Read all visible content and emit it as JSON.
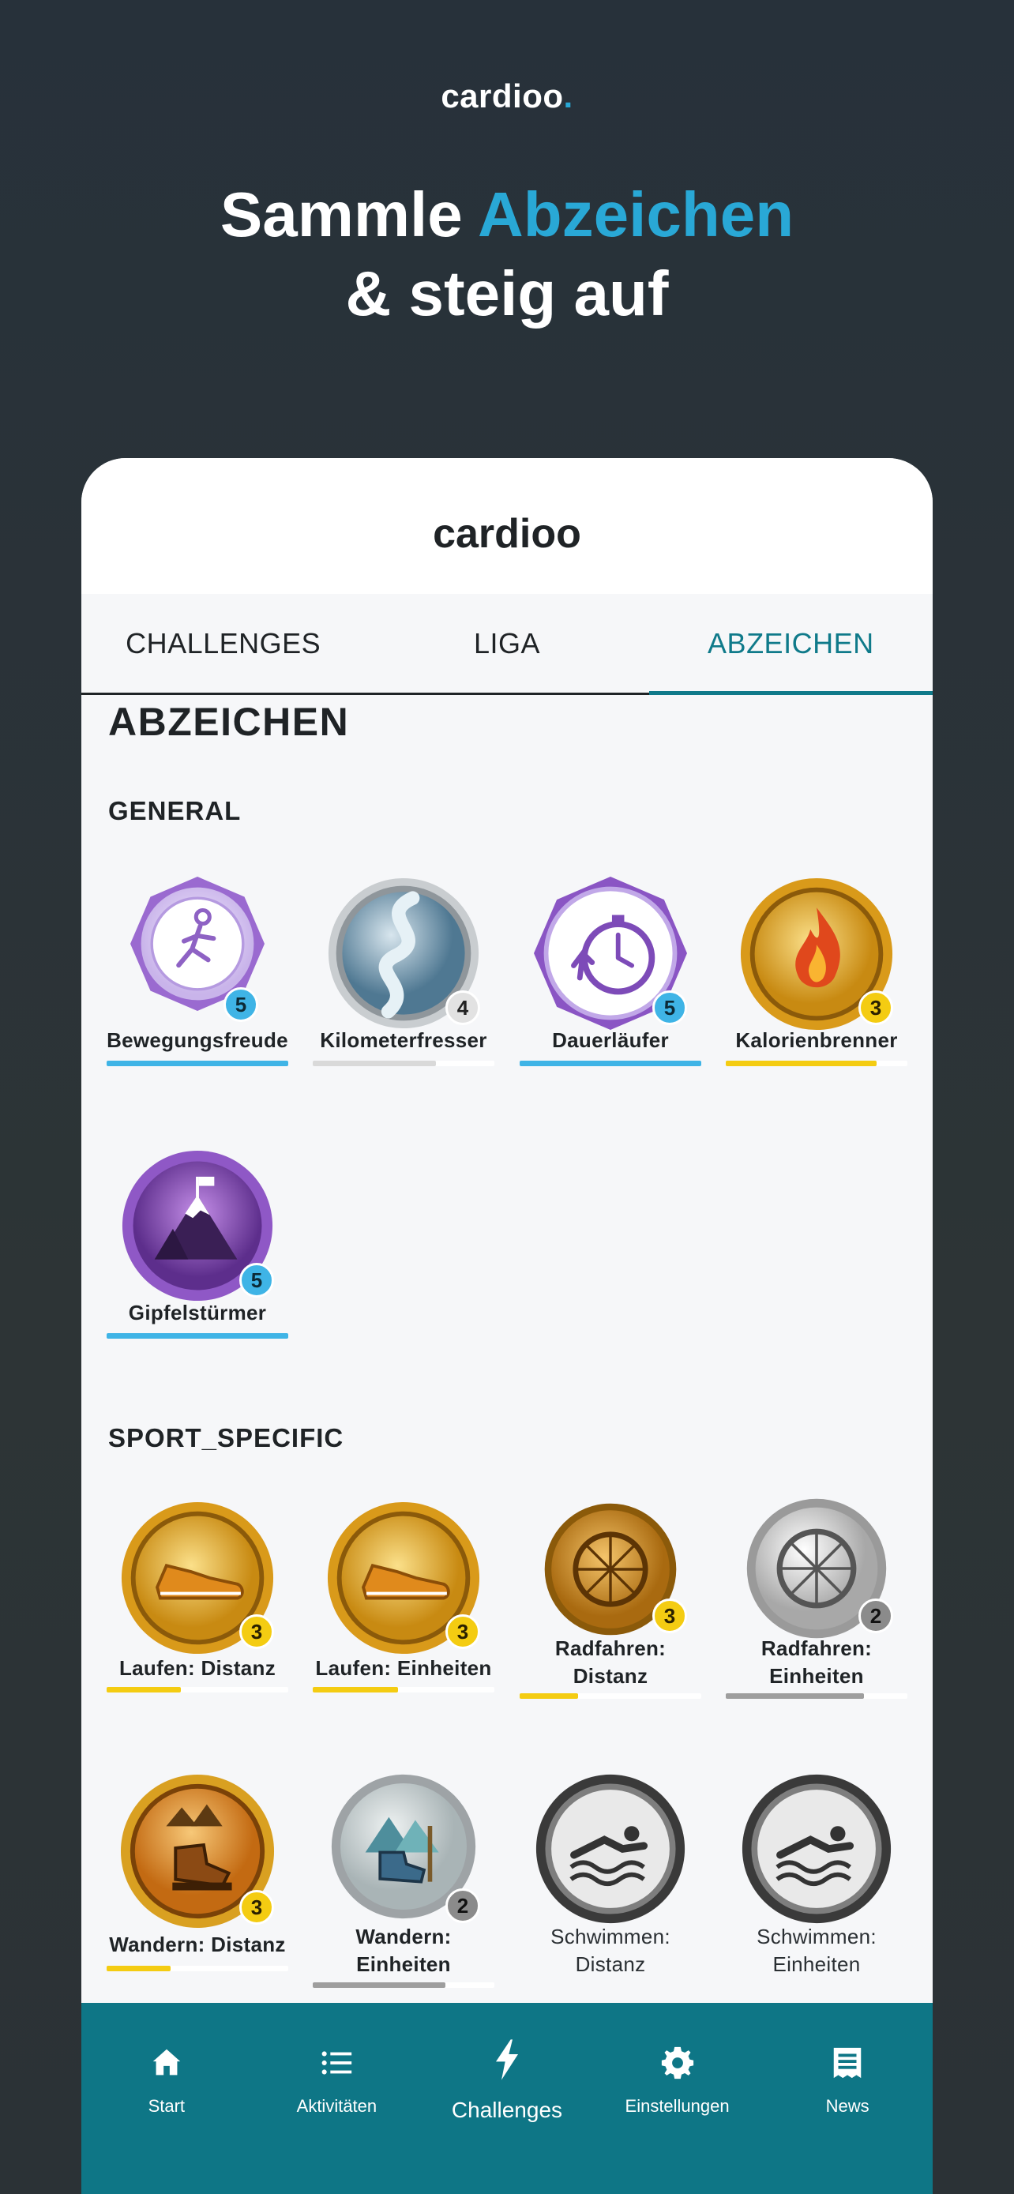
{
  "promo": {
    "brand": "cardioo",
    "brand_dot": ".",
    "headline_part1": "Sammle ",
    "headline_accent": "Abzeichen",
    "headline_line2": "& steig auf"
  },
  "app": {
    "title": "cardioo",
    "tabs": [
      {
        "label": "CHALLENGES",
        "active": false
      },
      {
        "label": "LIGA",
        "active": false
      },
      {
        "label": "ABZEICHEN",
        "active": true
      }
    ],
    "page_title": "ABZEICHEN",
    "sections": [
      {
        "title": "GENERAL",
        "badges": [
          {
            "label": "Bewegungsfreude",
            "level": "5",
            "progress": 1.0,
            "icon": "runner-icon"
          },
          {
            "label": "Kilometerfresser",
            "level": "4",
            "progress": 0.68,
            "icon": "road-icon"
          },
          {
            "label": "Dauerläufer",
            "level": "5",
            "progress": 1.0,
            "icon": "stopwatch-icon"
          },
          {
            "label": "Kalorienbrenner",
            "level": "3",
            "progress": 0.83,
            "icon": "flame-icon"
          },
          {
            "label": "Gipfelstürmer",
            "level": "5",
            "progress": 1.0,
            "icon": "mountain-icon"
          }
        ]
      },
      {
        "title": "SPORT_SPECIFIC",
        "badges": [
          {
            "label": "Laufen: Distanz",
            "level": "3",
            "progress": 0.41,
            "icon": "shoe-icon"
          },
          {
            "label": "Laufen: Einheiten",
            "level": "3",
            "progress": 0.47,
            "icon": "shoe-icon"
          },
          {
            "label": "Radfahren: Distanz",
            "level": "3",
            "progress": 0.32,
            "icon": "bike-wheel-icon"
          },
          {
            "label": "Radfahren: Einheiten",
            "level": "2",
            "progress": 0.76,
            "icon": "bike-wheel-icon"
          },
          {
            "label": "Wandern: Distanz",
            "level": "3",
            "progress": 0.35,
            "icon": "hiking-boot-icon"
          },
          {
            "label": "Wandern: Einheiten",
            "level": "2",
            "progress": 0.73,
            "icon": "hiking-boot-icon"
          },
          {
            "label": "Schwimmen: Distanz",
            "level": "",
            "progress": 0,
            "icon": "swimmer-icon"
          },
          {
            "label": "Schwimmen: Einheiten",
            "level": "",
            "progress": 0,
            "icon": "swimmer-icon"
          }
        ]
      }
    ],
    "nav": [
      {
        "label": "Start",
        "icon": "home-icon",
        "active": false
      },
      {
        "label": "Aktivitäten",
        "icon": "list-icon",
        "active": false
      },
      {
        "label": "Challenges",
        "icon": "bolt-icon",
        "active": true
      },
      {
        "label": "Einstellungen",
        "icon": "gear-icon",
        "active": false
      },
      {
        "label": "News",
        "icon": "newspaper-icon",
        "active": false
      }
    ]
  },
  "colors": {
    "accent": "#29a8d6",
    "teal": "#0e7686",
    "level_blue": "#3fb4e6",
    "level_yellow": "#f4cc12",
    "level_gray": "#8b8b8b"
  }
}
